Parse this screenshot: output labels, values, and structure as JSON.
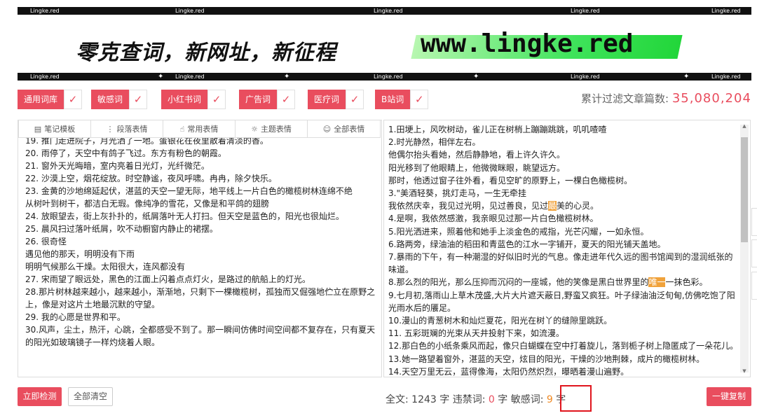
{
  "banner": {
    "strip_label": "Lingke.red",
    "slogan": "零克查词，新网址，新征程",
    "url": "www.lingke.red"
  },
  "tags": [
    {
      "label": "通用词库",
      "checked": true
    },
    {
      "label": "敏感词",
      "checked": true
    },
    {
      "label": "小红书词",
      "checked": true
    },
    {
      "label": "广告词",
      "checked": true
    },
    {
      "label": "医疗词",
      "checked": true
    },
    {
      "label": "B站词",
      "checked": true
    }
  ],
  "counter": {
    "label": "累计过滤文章篇数:",
    "value": "35,080,204"
  },
  "toolbar": [
    {
      "icon": "notebook-icon",
      "glyph": "▤",
      "label": "笔记模板"
    },
    {
      "icon": "paragraph-icon",
      "glyph": "⋮",
      "label": "段落表情"
    },
    {
      "icon": "hand-icon",
      "glyph": "☝",
      "label": "常用表情"
    },
    {
      "icon": "palette-icon",
      "glyph": "☼",
      "label": "主题表情"
    },
    {
      "icon": "smile-icon",
      "glyph": "☺",
      "label": "全部表情"
    }
  ],
  "left_lines": [
    "19.  推门走进院子，月光洒了一地。蛋银花在夜里散着清淡的香。",
    "20.  雨停了，天空中有鸽子飞过。东方有粉色的朝霞。",
    "21.  窗外天光晦暗，室内亮着日光灯，光纤微茫。",
    "22.  沙漠上空，烟花绽放。时空静谧，夜风呼啸。冉冉，除夕快乐。",
    "23.  金黄的沙地绵延起伏，湛蓝的天空一望无际，地平线上一片白色的橄榄树林连绵不绝",
    "从树叶到树干，都洁白无瑕。像纯净的雪花，又像是和平鸽的翅膀",
    "24.  放眼望去，街上灰扑扑的，纸屑落叶无人打扫。但天空是蓝色的，阳光也很灿烂。",
    "25.  晨风扫过落叶纸屑，吹不动橱窗内静止的裙摆。",
    "26.  很奇怪",
    " 遇见他的那天，明明没有下雨",
    " 明明气候那么干燥。太阳很大，连风都没有",
    "27.  宋雨望了眼远处，黑色的江面上闪着点点灯火，是路过的航船上的灯光。",
    "28.那片树林越来越小，越来越小，渐渐地，只剩下一棵橄榄树，孤独而又倔强地伫立在原野之上，像是对这片土地最沉默的守望。",
    "29.  我的心愿是世界和平。",
    "30.风声，尘土，热汗，心跳，全都感受不到了。那一瞬间仿佛时间空间都不复存在，只有夏天的阳光如玻璃镜子一样灼烧着人眼。"
  ],
  "right_lines": [
    {
      "text": "1.田埂上，风吹树动，雀儿正在树梢上蹦蹦跳跳，叽叽喳喳"
    },
    {
      "text": "2.时光静然，相伴左右。"
    },
    {
      "text": "他偶尔抬头看她，然后静静地，看上许久许久。"
    },
    {
      "text": "阳光移到了他眼睛上，他微微眯眼，眺望远方。"
    },
    {
      "text": "那时，他透过窗子往外看，看见空旷的原野上，一棵白色橄榄树。"
    },
    {
      "text": "3.\"美酒轻葵，挑灯走马，一生无牵挂"
    },
    {
      "text": "我依然庆幸，我见过光明，见过善良，见过",
      "hl": "最",
      "after": "美的心灵。"
    },
    {
      "text": "4.是啊，我依然感激，我亲眼见过那一片白色橄榄树林。"
    },
    {
      "text": "5.阳光洒进来，照着他和她手上淡金色的戒指，光芒闪耀，一如永恒。"
    },
    {
      "text": "6.路两旁，绿油油的稻田和青蓝色的江水一字铺开，夏天的阳光铺天盖地。"
    },
    {
      "text": "7.暴雨的下午，有一种潮湿的好似旧时光的气息。像走进年代久远的图书馆闻到的湿润纸张的味道。"
    },
    {
      "text": "8.那么烈的阳光，那么压抑而沉闷的一座城，他的笑像是黑白世界里的",
      "hl": "唯一",
      "after": "一抹色彩。"
    },
    {
      "text": "9.七月初,落雨山上草木茂盛,大片大片遮天蔽日,野蛮又疯狂。叶子绿油油泛旬甸,仿佛吃饱了阳光雨水后的餍足。"
    },
    {
      "text": "10.漫山的青葱树木和灿烂夏花，阳光在树丫的缝隙里跳跃。"
    },
    {
      "text": "11. 五彩斑斓的光束从天井投射下来，如流漫。"
    },
    {
      "text": "12.那白色的小纸条乘风而起，像只白蝴蝶在空中打着旋儿，落到栀子树上隐匿成了一朵花儿。"
    },
    {
      "text": "13.她一路望着窗外，湛蓝的天空，炫目的阳光，干燥的沙地荆棘，成片的橄榄树林。"
    },
    {
      "text": "14.天空万里无云，蓝得像海，太阳仍然炽烈，曝晒着漫山遍野。"
    }
  ],
  "buttons": {
    "detect": "立即检测",
    "clear": "全部清空",
    "copy": "一键复制"
  },
  "stats": {
    "total_label": "全文:",
    "total_value": "1243",
    "unit": "字",
    "banned_label": "违禁词:",
    "banned_value": "0",
    "sensitive_label": "敏感词:",
    "sensitive_value": "9"
  },
  "colors": {
    "accent": "#e94d5e",
    "highlight": "#f0a23b",
    "callout": "#e0151d"
  }
}
